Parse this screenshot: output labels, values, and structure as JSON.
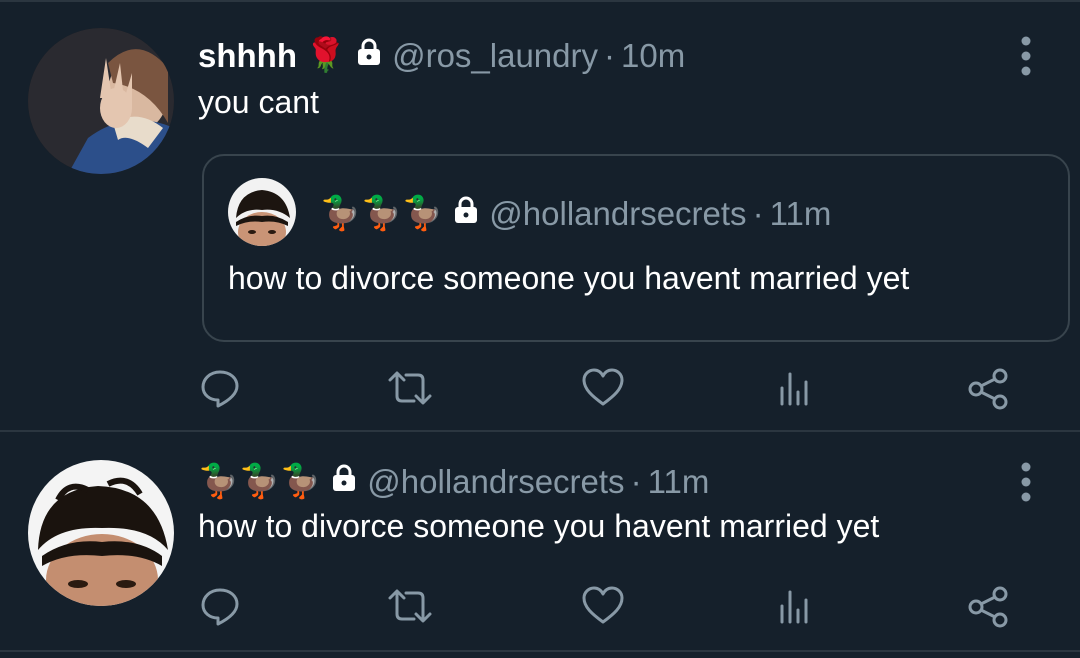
{
  "tweets": [
    {
      "display_name": "shhhh",
      "name_emoji": "🌹",
      "handle": "@ros_laundry",
      "separator": "·",
      "time": "10m",
      "text": "you cant",
      "quote": {
        "name_emoji": "🦆🦆🦆",
        "handle": "@hollandrsecrets",
        "separator": "·",
        "time": "11m",
        "text": "how to divorce someone you havent married yet"
      }
    },
    {
      "name_emoji": "🦆🦆🦆",
      "handle": "@hollandrsecrets",
      "separator": "·",
      "time": "11m",
      "text": "how to divorce someone you havent married yet"
    }
  ],
  "icons": {
    "reply": "reply-icon",
    "retweet": "retweet-icon",
    "like": "heart-icon",
    "stats": "stats-icon",
    "share": "share-icon",
    "more": "more-vertical-icon",
    "lock": "lock-icon"
  },
  "colors": {
    "background": "#15202b",
    "secondary_text": "#8899a6",
    "divider": "#2b3640"
  }
}
